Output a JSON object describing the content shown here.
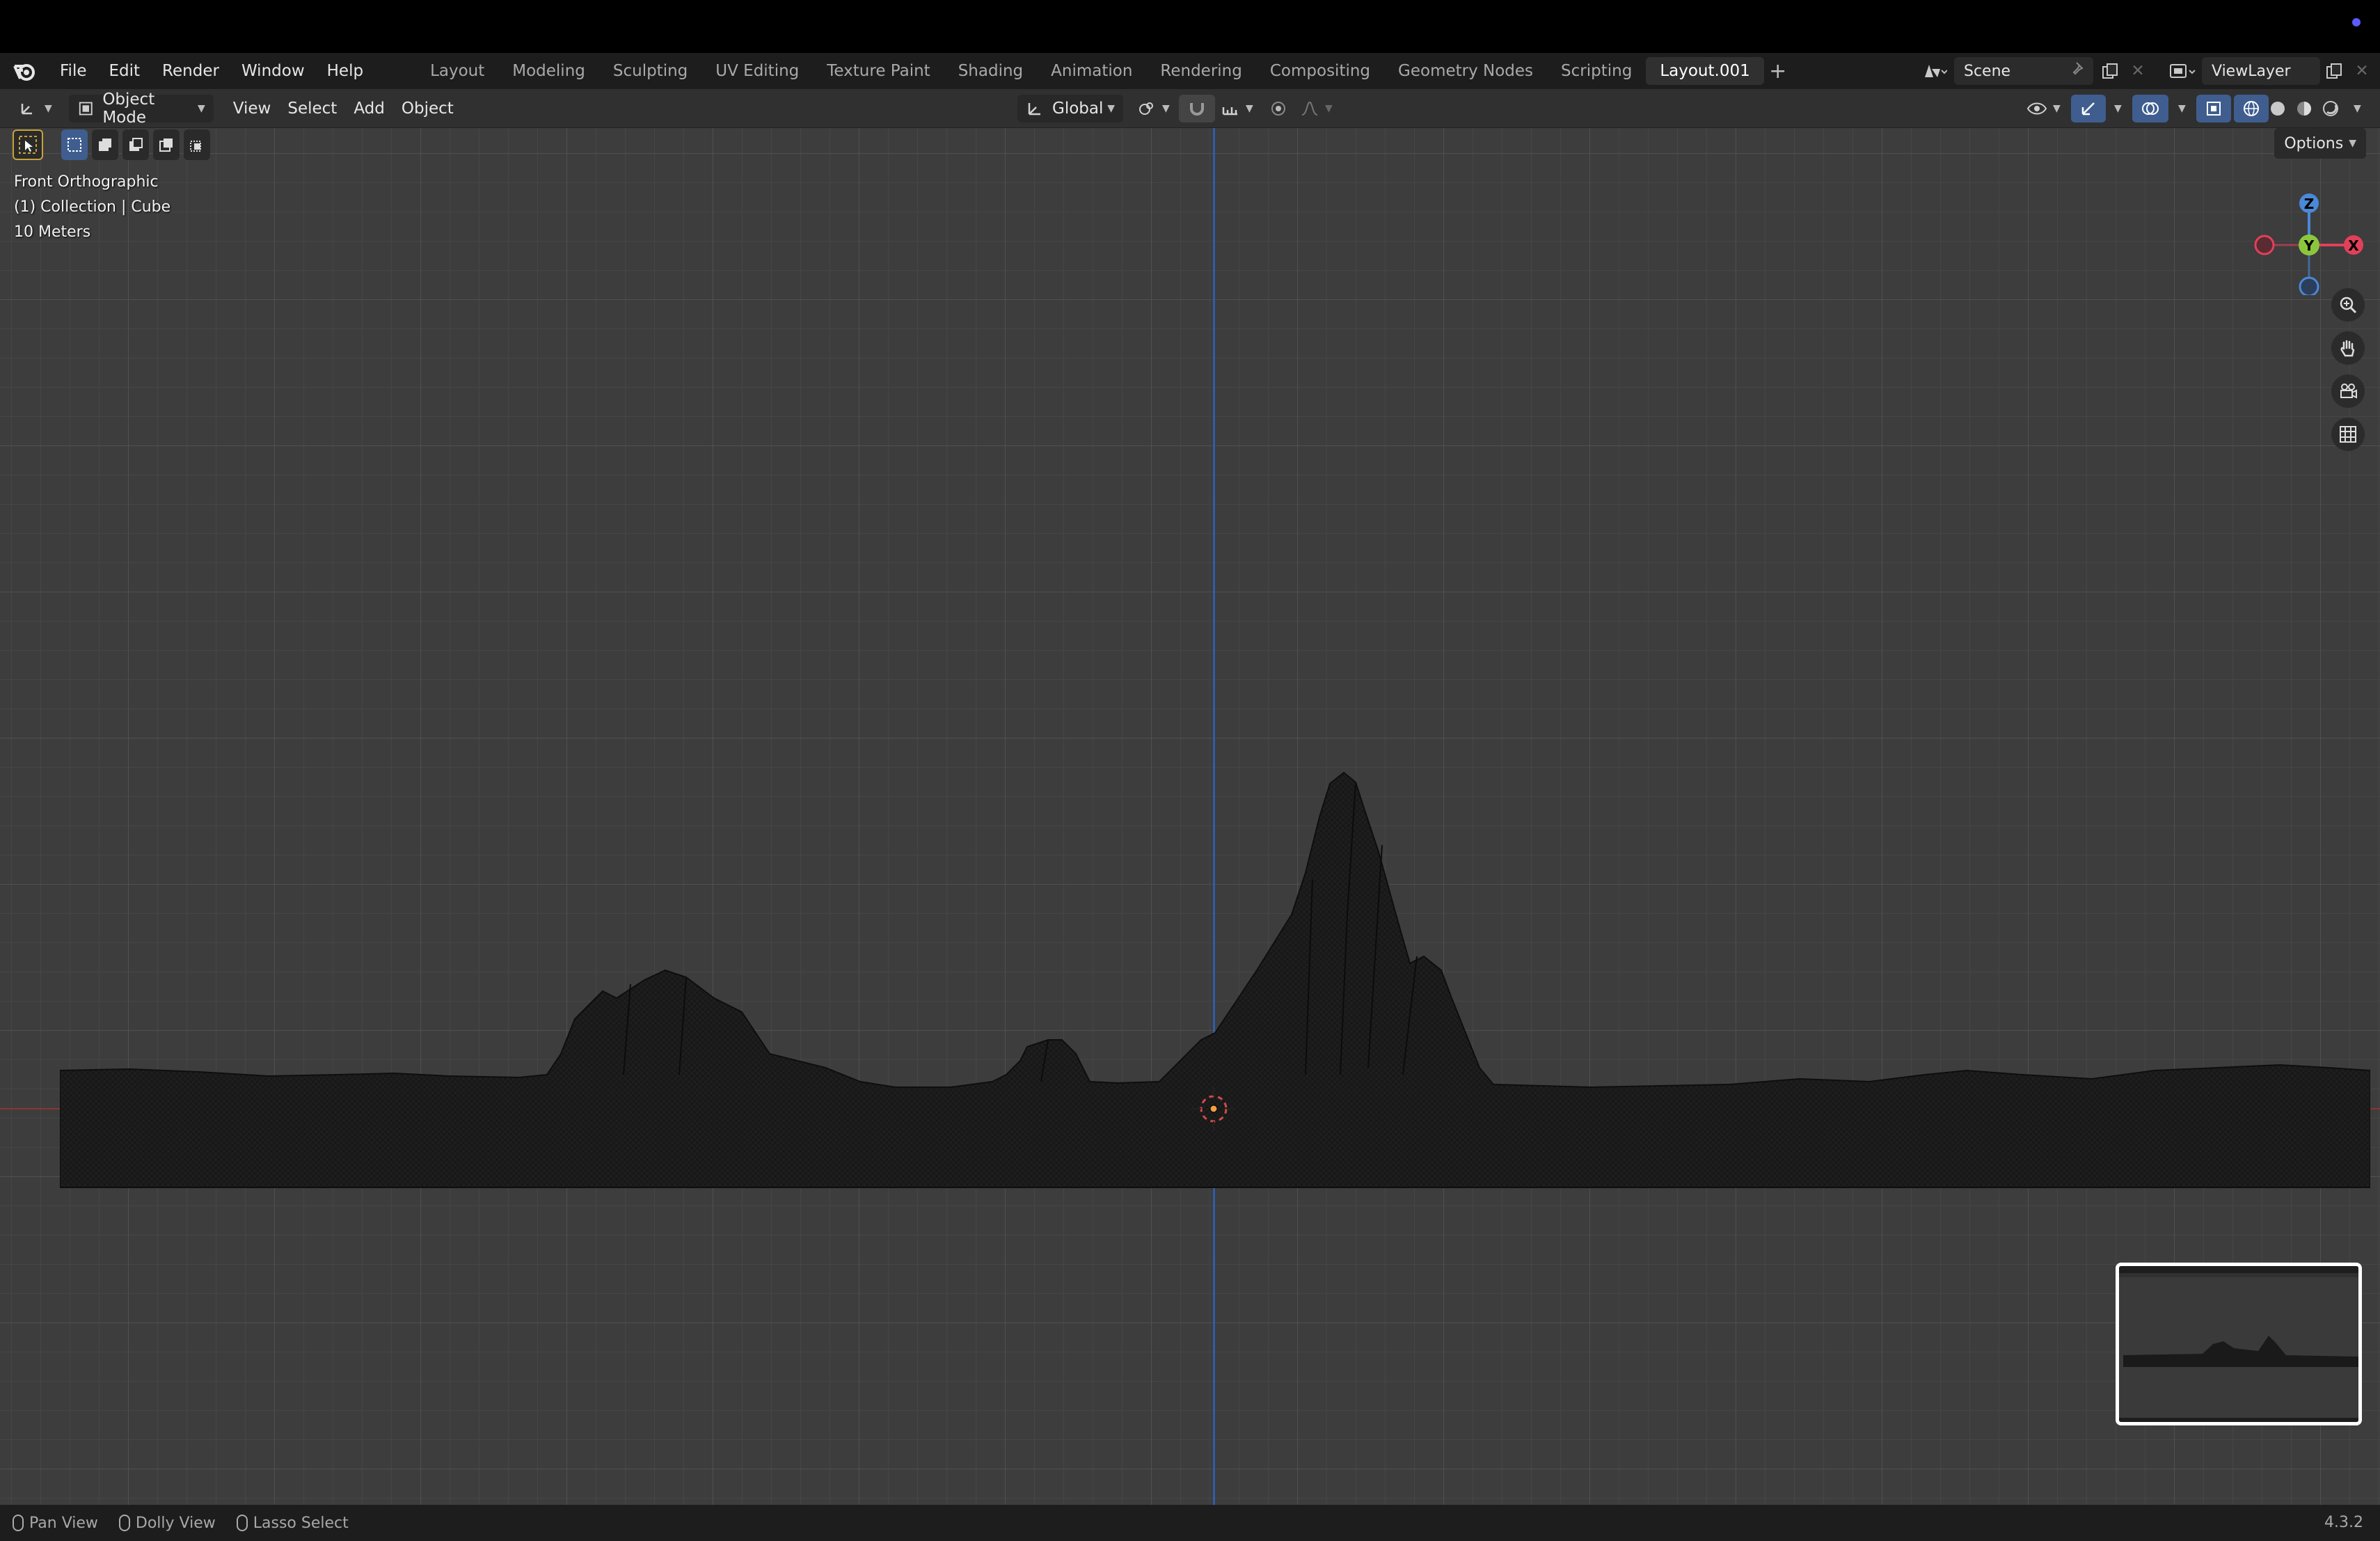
{
  "topbar": {
    "menus": [
      "File",
      "Edit",
      "Render",
      "Window",
      "Help"
    ],
    "workspaces": [
      "Layout",
      "Modeling",
      "Sculpting",
      "UV Editing",
      "Texture Paint",
      "Shading",
      "Animation",
      "Rendering",
      "Compositing",
      "Geometry Nodes",
      "Scripting",
      "Layout.001"
    ],
    "active_workspace": "Layout.001",
    "scene_name": "Scene",
    "view_layer": "ViewLayer"
  },
  "header": {
    "mode": "Object Mode",
    "menus": [
      "View",
      "Select",
      "Add",
      "Object"
    ],
    "orientation": "Global"
  },
  "viewport": {
    "view_name": "Front Orthographic",
    "collection_info": "(1) Collection | Cube",
    "scale_info": "10 Meters",
    "options_label": "Options",
    "gizmo": {
      "z": "Z",
      "y": "Y",
      "x": "X"
    }
  },
  "statusbar": {
    "pan": "Pan View",
    "dolly": "Dolly View",
    "lasso": "Lasso Select",
    "version": "4.3.2"
  },
  "colors": {
    "accent_blue": "#3f5e8f",
    "axis_x": "#e2405a",
    "axis_y": "#8cc63e",
    "axis_z": "#4a88d8"
  }
}
